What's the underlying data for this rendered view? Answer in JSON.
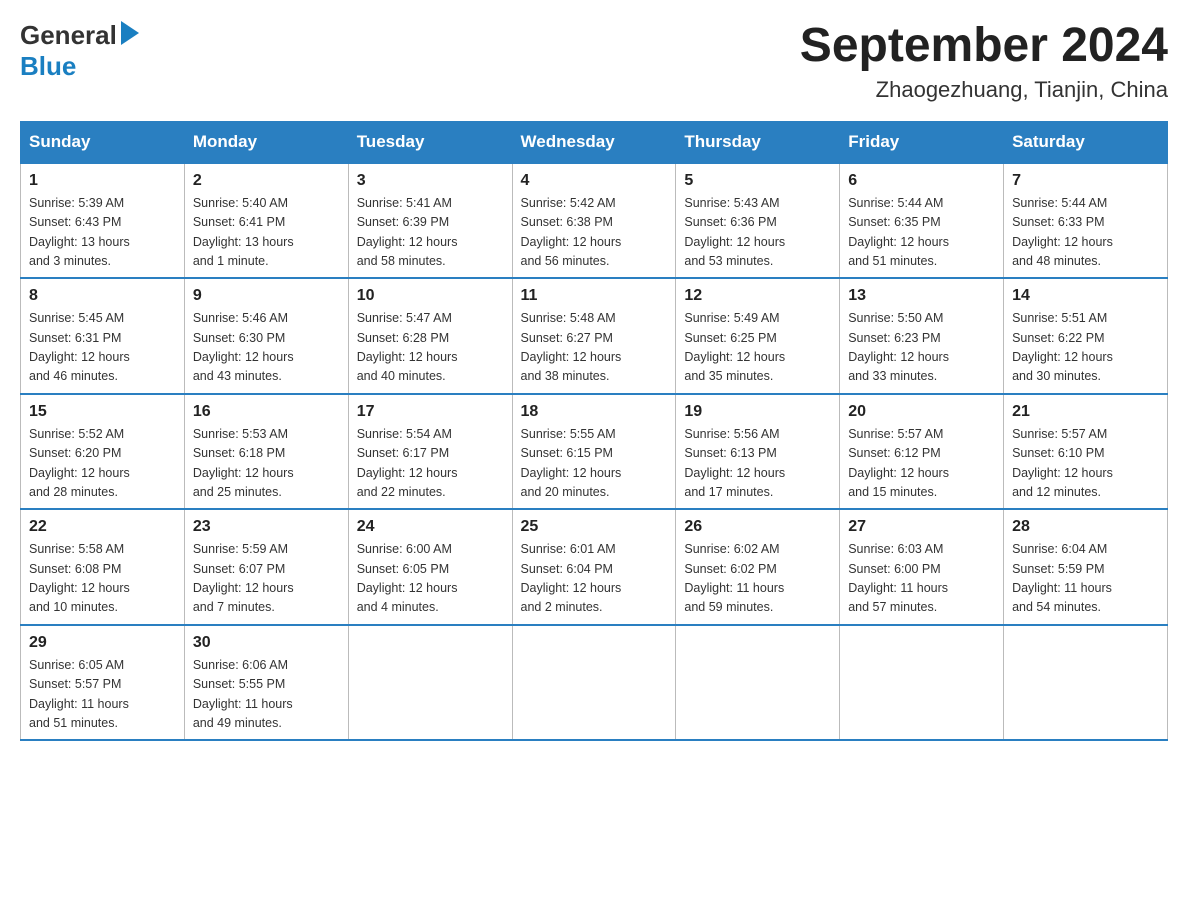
{
  "header": {
    "logo_general": "General",
    "logo_blue": "Blue",
    "month_year": "September 2024",
    "location": "Zhaogezhuang, Tianjin, China"
  },
  "days_of_week": [
    "Sunday",
    "Monday",
    "Tuesday",
    "Wednesday",
    "Thursday",
    "Friday",
    "Saturday"
  ],
  "weeks": [
    [
      {
        "day": "1",
        "sunrise": "5:39 AM",
        "sunset": "6:43 PM",
        "daylight": "13 hours and 3 minutes."
      },
      {
        "day": "2",
        "sunrise": "5:40 AM",
        "sunset": "6:41 PM",
        "daylight": "13 hours and 1 minute."
      },
      {
        "day": "3",
        "sunrise": "5:41 AM",
        "sunset": "6:39 PM",
        "daylight": "12 hours and 58 minutes."
      },
      {
        "day": "4",
        "sunrise": "5:42 AM",
        "sunset": "6:38 PM",
        "daylight": "12 hours and 56 minutes."
      },
      {
        "day": "5",
        "sunrise": "5:43 AM",
        "sunset": "6:36 PM",
        "daylight": "12 hours and 53 minutes."
      },
      {
        "day": "6",
        "sunrise": "5:44 AM",
        "sunset": "6:35 PM",
        "daylight": "12 hours and 51 minutes."
      },
      {
        "day": "7",
        "sunrise": "5:44 AM",
        "sunset": "6:33 PM",
        "daylight": "12 hours and 48 minutes."
      }
    ],
    [
      {
        "day": "8",
        "sunrise": "5:45 AM",
        "sunset": "6:31 PM",
        "daylight": "12 hours and 46 minutes."
      },
      {
        "day": "9",
        "sunrise": "5:46 AM",
        "sunset": "6:30 PM",
        "daylight": "12 hours and 43 minutes."
      },
      {
        "day": "10",
        "sunrise": "5:47 AM",
        "sunset": "6:28 PM",
        "daylight": "12 hours and 40 minutes."
      },
      {
        "day": "11",
        "sunrise": "5:48 AM",
        "sunset": "6:27 PM",
        "daylight": "12 hours and 38 minutes."
      },
      {
        "day": "12",
        "sunrise": "5:49 AM",
        "sunset": "6:25 PM",
        "daylight": "12 hours and 35 minutes."
      },
      {
        "day": "13",
        "sunrise": "5:50 AM",
        "sunset": "6:23 PM",
        "daylight": "12 hours and 33 minutes."
      },
      {
        "day": "14",
        "sunrise": "5:51 AM",
        "sunset": "6:22 PM",
        "daylight": "12 hours and 30 minutes."
      }
    ],
    [
      {
        "day": "15",
        "sunrise": "5:52 AM",
        "sunset": "6:20 PM",
        "daylight": "12 hours and 28 minutes."
      },
      {
        "day": "16",
        "sunrise": "5:53 AM",
        "sunset": "6:18 PM",
        "daylight": "12 hours and 25 minutes."
      },
      {
        "day": "17",
        "sunrise": "5:54 AM",
        "sunset": "6:17 PM",
        "daylight": "12 hours and 22 minutes."
      },
      {
        "day": "18",
        "sunrise": "5:55 AM",
        "sunset": "6:15 PM",
        "daylight": "12 hours and 20 minutes."
      },
      {
        "day": "19",
        "sunrise": "5:56 AM",
        "sunset": "6:13 PM",
        "daylight": "12 hours and 17 minutes."
      },
      {
        "day": "20",
        "sunrise": "5:57 AM",
        "sunset": "6:12 PM",
        "daylight": "12 hours and 15 minutes."
      },
      {
        "day": "21",
        "sunrise": "5:57 AM",
        "sunset": "6:10 PM",
        "daylight": "12 hours and 12 minutes."
      }
    ],
    [
      {
        "day": "22",
        "sunrise": "5:58 AM",
        "sunset": "6:08 PM",
        "daylight": "12 hours and 10 minutes."
      },
      {
        "day": "23",
        "sunrise": "5:59 AM",
        "sunset": "6:07 PM",
        "daylight": "12 hours and 7 minutes."
      },
      {
        "day": "24",
        "sunrise": "6:00 AM",
        "sunset": "6:05 PM",
        "daylight": "12 hours and 4 minutes."
      },
      {
        "day": "25",
        "sunrise": "6:01 AM",
        "sunset": "6:04 PM",
        "daylight": "12 hours and 2 minutes."
      },
      {
        "day": "26",
        "sunrise": "6:02 AM",
        "sunset": "6:02 PM",
        "daylight": "11 hours and 59 minutes."
      },
      {
        "day": "27",
        "sunrise": "6:03 AM",
        "sunset": "6:00 PM",
        "daylight": "11 hours and 57 minutes."
      },
      {
        "day": "28",
        "sunrise": "6:04 AM",
        "sunset": "5:59 PM",
        "daylight": "11 hours and 54 minutes."
      }
    ],
    [
      {
        "day": "29",
        "sunrise": "6:05 AM",
        "sunset": "5:57 PM",
        "daylight": "11 hours and 51 minutes."
      },
      {
        "day": "30",
        "sunrise": "6:06 AM",
        "sunset": "5:55 PM",
        "daylight": "11 hours and 49 minutes."
      },
      null,
      null,
      null,
      null,
      null
    ]
  ],
  "labels": {
    "sunrise": "Sunrise:",
    "sunset": "Sunset:",
    "daylight": "Daylight:"
  }
}
